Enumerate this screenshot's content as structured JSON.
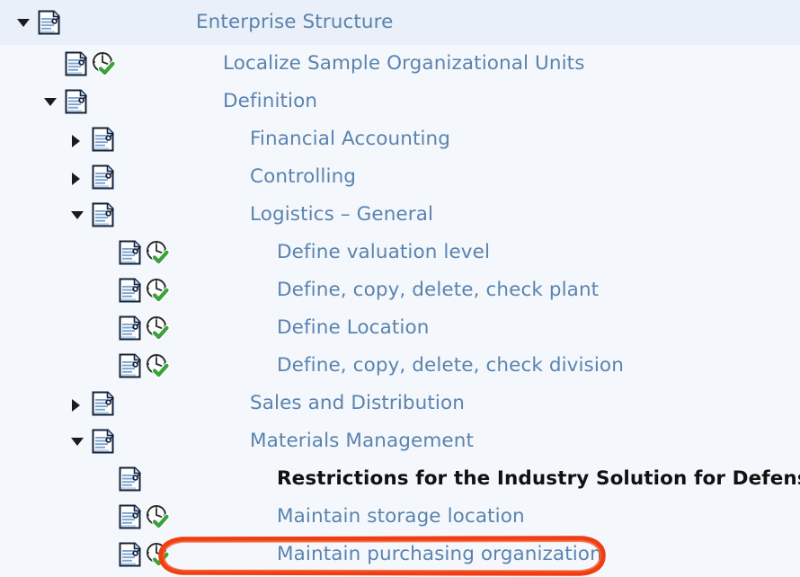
{
  "theme": {
    "link_color": "#5b83ad",
    "plain_text_color": "#111111",
    "row_background": "#f4f8fd",
    "selected_row_background": "#e9f0f9",
    "annotation_color": "#f03e14"
  },
  "tree": {
    "name": "implementation-guide-tree",
    "rows": [
      {
        "label": "Enterprise Structure",
        "depth": 0,
        "expander": "expanded",
        "doc_icon": "document-icon",
        "clock_icon": null,
        "style": "link",
        "selected": true,
        "annotated": false
      },
      {
        "label": "Localize Sample Organizational Units",
        "depth": 1,
        "expander": "none",
        "doc_icon": "document-icon",
        "clock_icon": "clock-check-icon",
        "style": "link",
        "selected": false,
        "annotated": false
      },
      {
        "label": "Definition",
        "depth": 1,
        "expander": "expanded",
        "doc_icon": "document-icon",
        "clock_icon": null,
        "style": "link",
        "selected": false,
        "annotated": false
      },
      {
        "label": "Financial Accounting",
        "depth": 2,
        "expander": "collapsed",
        "doc_icon": "document-icon",
        "clock_icon": null,
        "style": "link",
        "selected": false,
        "annotated": false
      },
      {
        "label": "Controlling",
        "depth": 2,
        "expander": "collapsed",
        "doc_icon": "document-icon",
        "clock_icon": null,
        "style": "link",
        "selected": false,
        "annotated": false
      },
      {
        "label": "Logistics – General",
        "depth": 2,
        "expander": "expanded",
        "doc_icon": "document-icon",
        "clock_icon": null,
        "style": "link",
        "selected": false,
        "annotated": false
      },
      {
        "label": "Define valuation level",
        "depth": 3,
        "expander": "none",
        "doc_icon": "document-icon",
        "clock_icon": "clock-check-icon",
        "style": "link",
        "selected": false,
        "annotated": false
      },
      {
        "label": "Define, copy, delete, check plant",
        "depth": 3,
        "expander": "none",
        "doc_icon": "document-icon",
        "clock_icon": "clock-check-icon",
        "style": "link",
        "selected": false,
        "annotated": false
      },
      {
        "label": "Define Location",
        "depth": 3,
        "expander": "none",
        "doc_icon": "document-icon",
        "clock_icon": "clock-check-icon",
        "style": "link",
        "selected": false,
        "annotated": false
      },
      {
        "label": "Define, copy, delete, check division",
        "depth": 3,
        "expander": "none",
        "doc_icon": "document-icon",
        "clock_icon": "clock-check-icon",
        "style": "link",
        "selected": false,
        "annotated": false
      },
      {
        "label": "Sales and Distribution",
        "depth": 2,
        "expander": "collapsed",
        "doc_icon": "document-icon",
        "clock_icon": null,
        "style": "link",
        "selected": false,
        "annotated": false
      },
      {
        "label": "Materials Management",
        "depth": 2,
        "expander": "expanded",
        "doc_icon": "document-icon",
        "clock_icon": null,
        "style": "link",
        "selected": false,
        "annotated": false
      },
      {
        "label": "Restrictions for the Industry Solution for Defense Forces",
        "depth": 3,
        "expander": "none",
        "doc_icon": "document-icon",
        "clock_icon": null,
        "style": "plain",
        "selected": false,
        "annotated": false
      },
      {
        "label": "Maintain storage location",
        "depth": 3,
        "expander": "none",
        "doc_icon": "document-icon",
        "clock_icon": "clock-check-icon",
        "style": "link",
        "selected": false,
        "annotated": false
      },
      {
        "label": "Maintain purchasing organization",
        "depth": 3,
        "expander": "none",
        "doc_icon": "document-icon",
        "clock_icon": "clock-check-icon",
        "style": "link",
        "selected": false,
        "annotated": true
      }
    ]
  },
  "annotation": {
    "shape": "ellipse-highlight",
    "target_label": "Maintain purchasing organization"
  }
}
